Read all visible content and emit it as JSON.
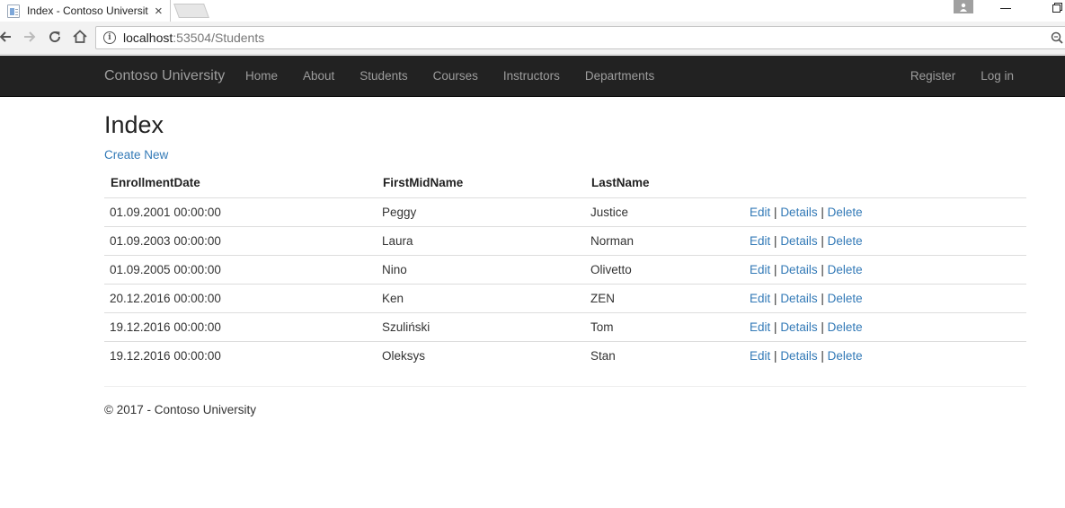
{
  "browser": {
    "tab_title": "Index - Contoso Universit",
    "tab_close": "×",
    "url_host": "localhost",
    "url_path": ":53504/Students"
  },
  "navbar": {
    "brand": "Contoso University",
    "links": [
      "Home",
      "About",
      "Students",
      "Courses",
      "Instructors",
      "Departments"
    ],
    "right": [
      "Register",
      "Log in"
    ]
  },
  "page": {
    "title": "Index",
    "create_new": "Create New"
  },
  "table": {
    "headers": [
      "EnrollmentDate",
      "FirstMidName",
      "LastName"
    ],
    "rows": [
      {
        "date": "01.09.2001 00:00:00",
        "first": "Peggy",
        "last": "Justice"
      },
      {
        "date": "01.09.2003 00:00:00",
        "first": "Laura",
        "last": "Norman"
      },
      {
        "date": "01.09.2005 00:00:00",
        "first": "Nino",
        "last": "Olivetto"
      },
      {
        "date": "20.12.2016 00:00:00",
        "first": "Ken",
        "last": "ZEN"
      },
      {
        "date": "19.12.2016 00:00:00",
        "first": "Szuliński",
        "last": "Tom"
      },
      {
        "date": "19.12.2016 00:00:00",
        "first": "Oleksys",
        "last": "Stan"
      }
    ],
    "actions": {
      "edit": "Edit",
      "details": "Details",
      "delete": "Delete",
      "separator": "|"
    }
  },
  "footer": {
    "text": "© 2017 - Contoso University"
  },
  "colors": {
    "navbar_bg": "#222222",
    "nav_text": "#9d9d9d",
    "link": "#337ab7"
  }
}
